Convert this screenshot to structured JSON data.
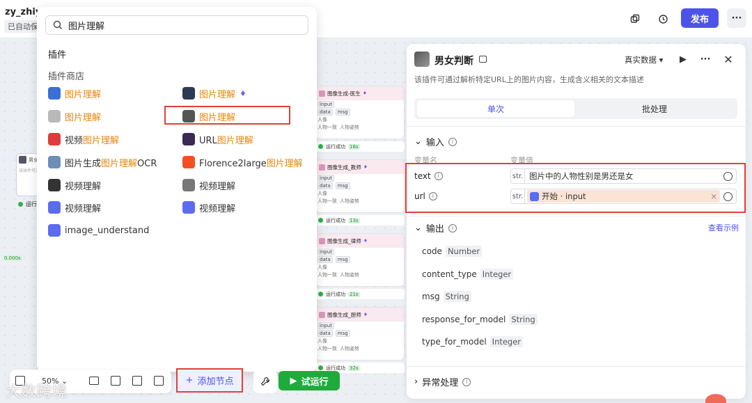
{
  "topbar": {
    "project": "zy_zhiy",
    "autosave": "已自动保",
    "publish": "发布"
  },
  "search": {
    "value": "图片理解"
  },
  "dropdown": {
    "section_plugins": "插件",
    "section_store": "插件商店",
    "items_left": [
      {
        "pre": "",
        "hl": "图片理解",
        "post": "",
        "color": "#3b6fd6"
      },
      {
        "pre": "",
        "hl": "图片理解",
        "post": "",
        "color": "#b9b9b9"
      },
      {
        "pre": "视频",
        "hl": "图片理解",
        "post": "",
        "color": "#e03c3c"
      },
      {
        "pre": "图片生成",
        "hl": "图片理解",
        "post": "OCR",
        "color": "#6c8fb8"
      },
      {
        "pre": "视频理解",
        "hl": "",
        "post": "",
        "color": "#333"
      },
      {
        "pre": "视频理解",
        "hl": "",
        "post": "",
        "color": "#5b6cf0"
      },
      {
        "pre": "image_understand",
        "hl": "",
        "post": "",
        "color": "#5b6cf0"
      }
    ],
    "items_right": [
      {
        "pre": "",
        "hl": "图片理解",
        "post": "",
        "color": "#2b3b52"
      },
      {
        "pre": "",
        "hl": "图片理解",
        "post": "",
        "color": "#555"
      },
      {
        "pre": "URL",
        "hl": "图片理解",
        "post": "",
        "color": "#3a2b52"
      },
      {
        "pre": "Florence2large",
        "hl": "图片理解",
        "post": "",
        "color": "#f25022"
      },
      {
        "pre": "视频理解",
        "hl": "",
        "post": "",
        "color": "#777"
      },
      {
        "pre": "视频理解",
        "hl": "",
        "post": "",
        "color": "#5b6cf0"
      }
    ]
  },
  "nodes": [
    {
      "title": "图像生成-医生",
      "run": "运行成功",
      "time": "16s"
    },
    {
      "title": "图像生成_教师",
      "run": "运行成功",
      "time": "13s"
    },
    {
      "title": "图像生成_律师",
      "run": "运行成功",
      "time": "21s"
    },
    {
      "title": "图像生成_厨师",
      "run": "运行成功",
      "time": "32s"
    }
  ],
  "node_rows": {
    "in": "input",
    "out1": "data",
    "out2": "msg",
    "img": "人像",
    "a": "人物一致",
    "b": "人物姿势"
  },
  "left_node": {
    "title": "男女",
    "run": "运行",
    "time": "0.000s"
  },
  "toolbar": {
    "zoom": "50%",
    "add_node": "添加节点",
    "try_run": "试运行"
  },
  "panel": {
    "title": "男女判断",
    "desc": "该插件可通过解析特定URL上的图片内容，生成含义相关的文本描述",
    "data_mode": "真实数据",
    "tab_single": "单次",
    "tab_batch": "批处理",
    "input_label": "输入",
    "col_name": "变量名",
    "col_value": "变量值",
    "inputs": [
      {
        "name": "text",
        "type": "str.",
        "value": "图片中的人物性别是男还是女"
      },
      {
        "name": "url",
        "type": "str.",
        "value": "开始 · input"
      }
    ],
    "output_label": "输出",
    "view_example": "查看示例",
    "outputs": [
      {
        "name": "code",
        "type": "Number"
      },
      {
        "name": "content_type",
        "type": "Integer"
      },
      {
        "name": "msg",
        "type": "String"
      },
      {
        "name": "response_for_model",
        "type": "String"
      },
      {
        "name": "type_for_model",
        "type": "Integer"
      }
    ],
    "exception_label": "异常处理"
  },
  "watermark": "大数跨境"
}
